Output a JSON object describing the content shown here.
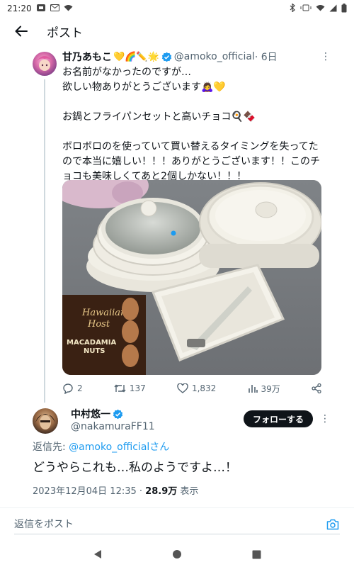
{
  "status_bar": {
    "time": "21:20",
    "left_icons": [
      "notification-icon",
      "mail-icon",
      "wifi-icon"
    ],
    "right_icons": [
      "bluetooth-icon",
      "vibrate-icon",
      "wifi-icon",
      "signal-icon",
      "battery-icon"
    ]
  },
  "header": {
    "title": "ポスト",
    "back_icon": "arrow-left-icon"
  },
  "quoted_post": {
    "name": "甘乃あもこ",
    "name_emojis": "💛🌈✏️🌟",
    "handle": "@amoko_official",
    "time": "· 6日",
    "text": "お名前がなかったのですが…\n欲しい物ありがとうございます🙇‍♀️💛\n\nお鍋とフライパンセットと高いチョコ🍳🍫\n\nボロボロのを使っていて買い替えるタイミングを失ってたので本当に嬉しい！！！ありがとうございます！！このチョコも美味しくてあと2個しかない！！！",
    "image_text": {
      "brand_line1": "Hawaiian",
      "brand_line2": "Host",
      "product_line1": "MACADAMIA",
      "product_line2": "NUTS"
    },
    "actions": {
      "replies": "2",
      "reposts": "137",
      "likes": "1,832",
      "views": "39万"
    }
  },
  "reply": {
    "name": "中村悠一",
    "handle": "@nakamuraFF11",
    "follow_label": "フォローする",
    "replying_prefix": "返信先: ",
    "replying_handle": "@amoko_official",
    "replying_suffix": "さん",
    "text": "どうやらこれも…私のようですよ…！",
    "timestamp": "2023年12月04日 12:35 · ",
    "views_count": "28.9万",
    "views_label": " 表示"
  },
  "compose": {
    "placeholder": "返信をポスト"
  },
  "colors": {
    "accent": "#1d9bf0",
    "text": "#0f1419",
    "secondary": "#536471",
    "follow_bg": "#0f1419"
  }
}
